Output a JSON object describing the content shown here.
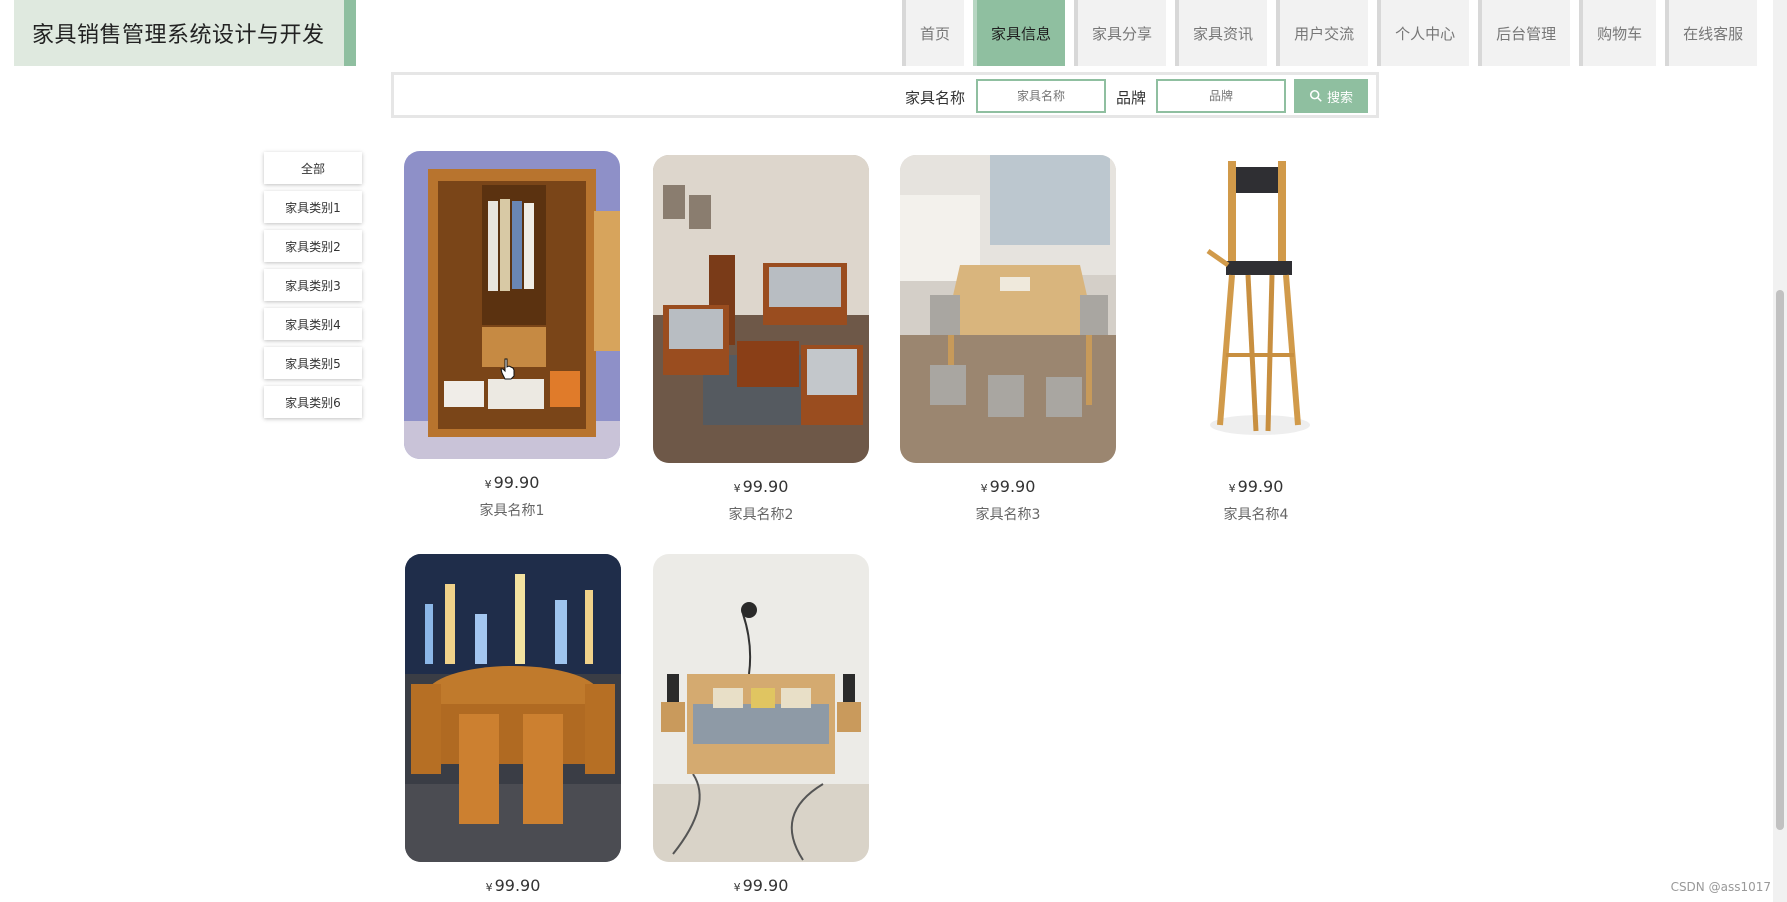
{
  "header": {
    "title": "家具销售管理系统设计与开发",
    "nav": [
      {
        "label": "首页",
        "active": false
      },
      {
        "label": "家具信息",
        "active": true
      },
      {
        "label": "家具分享",
        "active": false
      },
      {
        "label": "家具资讯",
        "active": false
      },
      {
        "label": "用户交流",
        "active": false
      },
      {
        "label": "个人中心",
        "active": false
      },
      {
        "label": "后台管理",
        "active": false
      },
      {
        "label": "购物车",
        "active": false
      },
      {
        "label": "在线客服",
        "active": false
      }
    ]
  },
  "search": {
    "name_label": "家具名称",
    "name_placeholder": "家具名称",
    "brand_label": "品牌",
    "brand_placeholder": "品牌",
    "button_label": "搜索"
  },
  "categories": [
    "全部",
    "家具类别1",
    "家具类别2",
    "家具类别3",
    "家具类别4",
    "家具类别5",
    "家具类别6"
  ],
  "products": [
    {
      "name": "家具名称1",
      "currency": "¥",
      "price": "99.90",
      "image": "wardrobe"
    },
    {
      "name": "家具名称2",
      "currency": "¥",
      "price": "99.90",
      "image": "sofa-set"
    },
    {
      "name": "家具名称3",
      "currency": "¥",
      "price": "99.90",
      "image": "dining-table"
    },
    {
      "name": "家具名称4",
      "currency": "¥",
      "price": "99.90",
      "image": "bar-chair"
    },
    {
      "name": "",
      "currency": "¥",
      "price": "99.90",
      "image": "dining-set-city"
    },
    {
      "name": "",
      "currency": "¥",
      "price": "99.90",
      "image": "bed"
    }
  ],
  "watermark": "CSDN @ass1017",
  "colors": {
    "accent": "#8fbfa0",
    "logo_bg": "#dfe9df",
    "nav_bg": "#f2f2f2"
  }
}
